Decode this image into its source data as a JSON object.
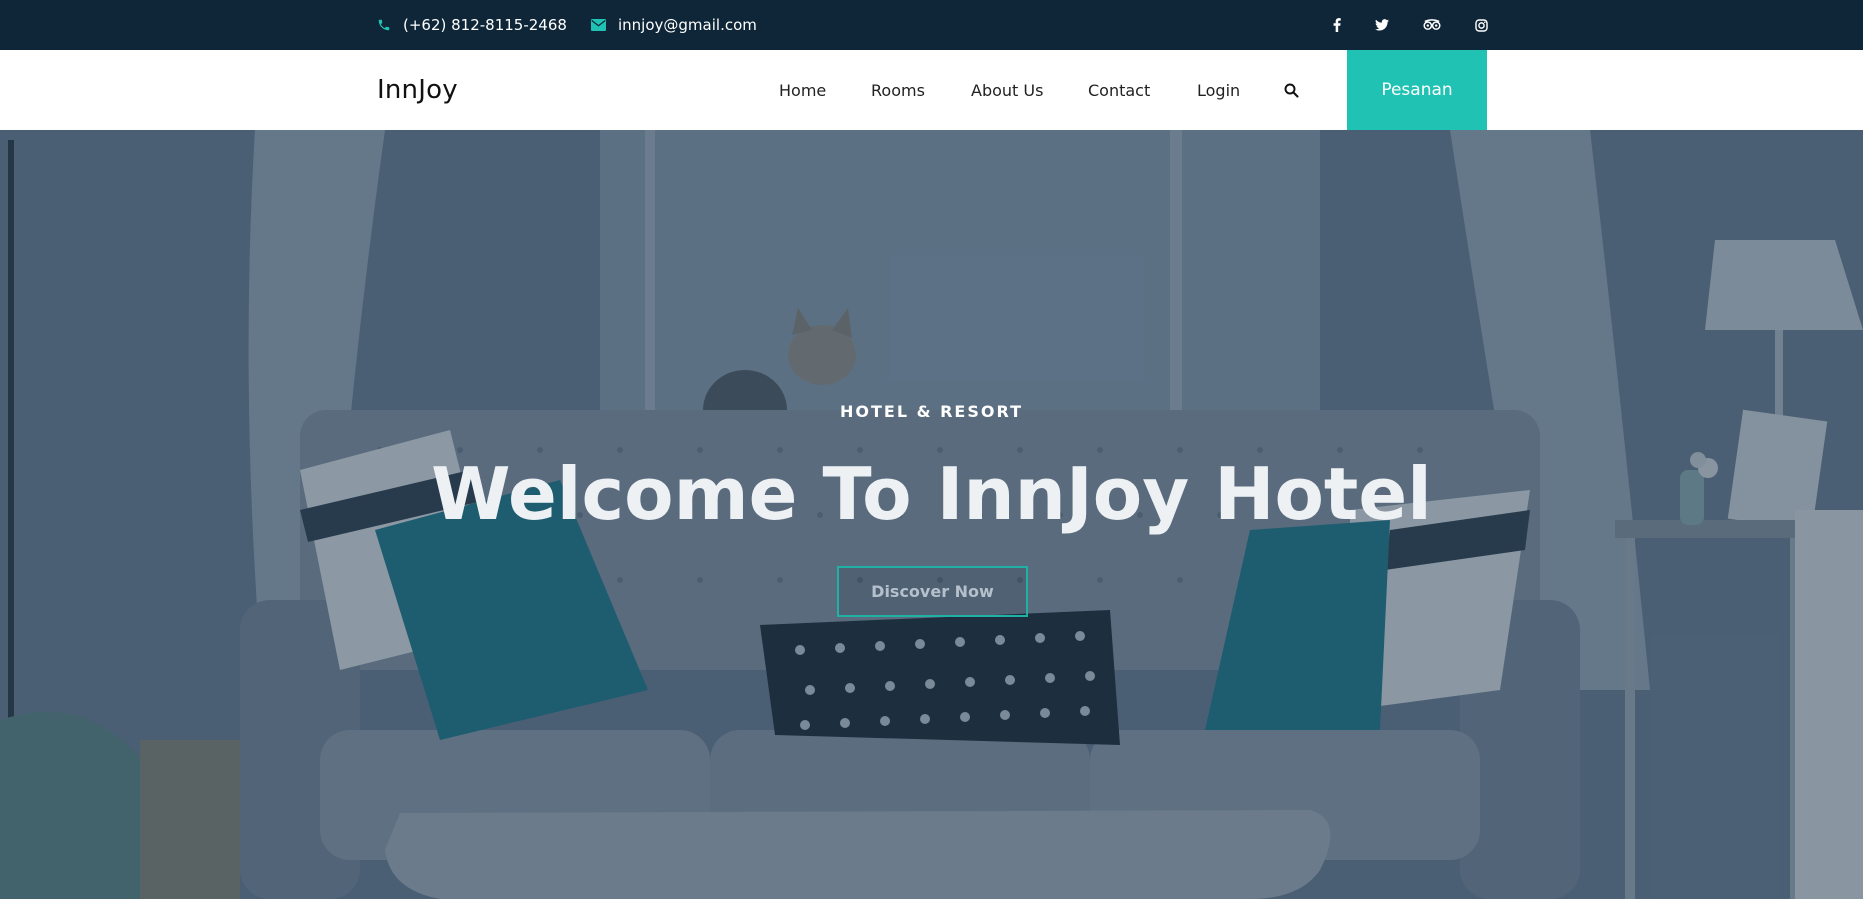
{
  "topbar": {
    "phone": "(+62) 812-8115-2468",
    "email": "innjoy@gmail.com",
    "social_icons": [
      "facebook-icon",
      "twitter-icon",
      "tripadvisor-icon",
      "instagram-icon"
    ]
  },
  "navbar": {
    "logo": "InnJoy",
    "items": [
      {
        "label": "Home"
      },
      {
        "label": "Rooms"
      },
      {
        "label": "About Us"
      },
      {
        "label": "Contact"
      },
      {
        "label": "Login"
      }
    ],
    "search_icon": "search-icon",
    "cta_label": "Pesanan"
  },
  "hero": {
    "eyebrow": "HOTEL & RESORT",
    "headline": "Welcome To InnJoy Hotel",
    "button_label": "Discover Now"
  },
  "colors": {
    "topbar_bg": "#0e2637",
    "accent": "#1fc2b3",
    "navbar_bg": "#ffffff"
  }
}
